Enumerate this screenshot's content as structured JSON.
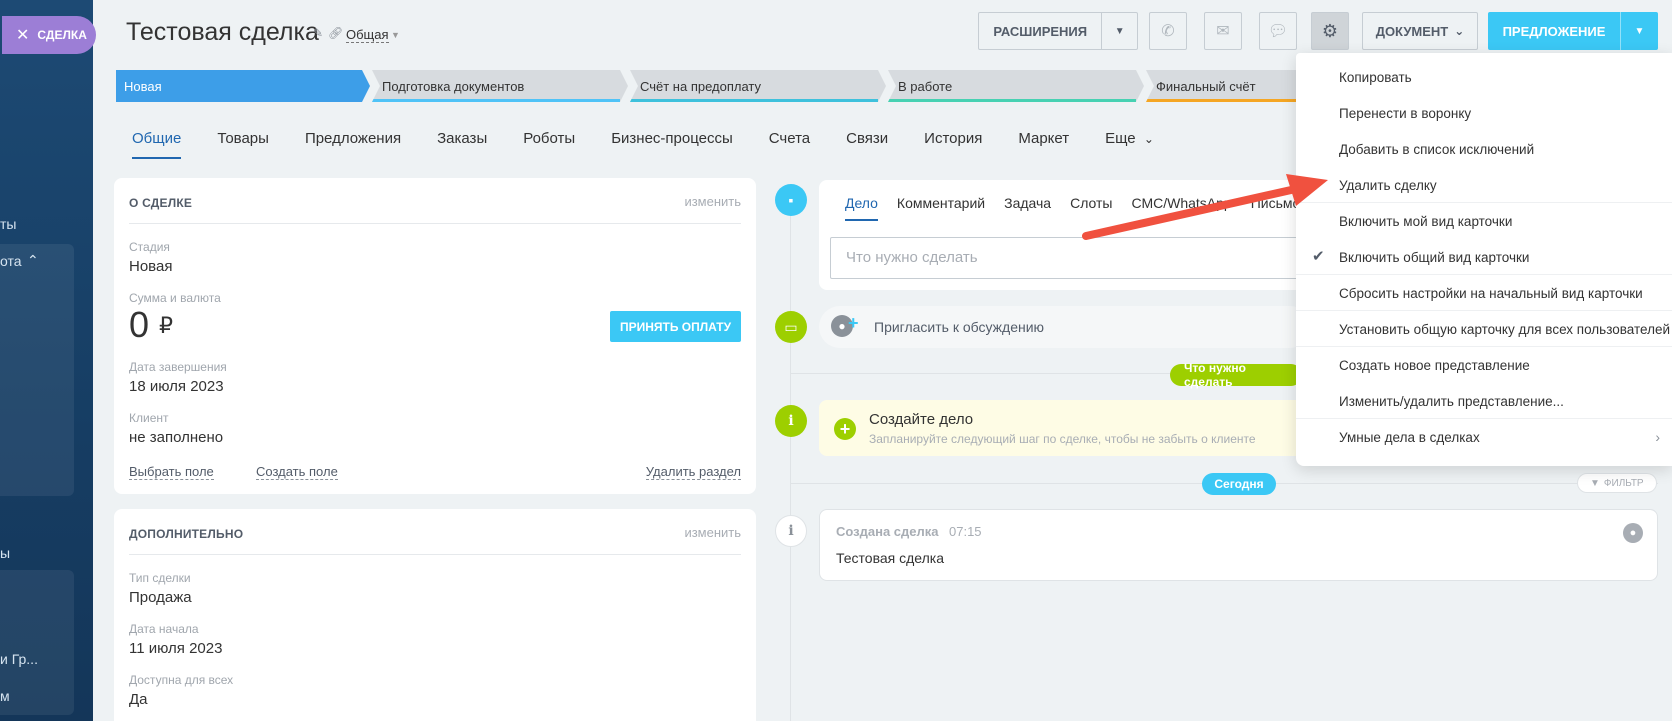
{
  "left_panel": {
    "close_deal_label": "СДЕЛКА",
    "fragment_1": "ты",
    "fragment_2": "ота",
    "fragment_3": "ы",
    "fragment_4": "и Гр...",
    "fragment_5": "м"
  },
  "header": {
    "title": "Тестовая сделка",
    "category": "Общая",
    "extensions_label": "РАСШИРЕНИЯ",
    "document_label": "ДОКУМЕНТ",
    "offer_label": "ПРЕДЛОЖЕНИЕ"
  },
  "stages": [
    {
      "label": "Новая",
      "color": "#3d9ee8"
    },
    {
      "label": "Подготовка документов",
      "color": "#4fc3f7"
    },
    {
      "label": "Счёт на предоплату",
      "color": "#3ec1dc"
    },
    {
      "label": "В работе",
      "color": "#47d1b2"
    },
    {
      "label": "Финальный счёт",
      "color": "#f5a623"
    }
  ],
  "tabs": [
    "Общие",
    "Товары",
    "Предложения",
    "Заказы",
    "Роботы",
    "Бизнес-процессы",
    "Счета",
    "Связи",
    "История",
    "Маркет",
    "Еще"
  ],
  "about": {
    "heading": "О СДЕЛКЕ",
    "edit": "изменить",
    "stage_label": "Стадия",
    "stage_value": "Новая",
    "amount_label": "Сумма и валюта",
    "amount_value": "0",
    "currency": "₽",
    "pay_button": "ПРИНЯТЬ ОПЛАТУ",
    "close_date_label": "Дата завершения",
    "close_date_value": "18 июля 2023",
    "client_label": "Клиент",
    "client_value": "не заполнено",
    "choose_field": "Выбрать поле",
    "create_field": "Создать поле",
    "delete_section": "Удалить раздел"
  },
  "extra": {
    "heading": "ДОПОЛНИТЕЛЬНО",
    "edit": "изменить",
    "deal_type_label": "Тип сделки",
    "deal_type_value": "Продажа",
    "start_date_label": "Дата начала",
    "start_date_value": "11 июля 2023",
    "available_label": "Доступна для всех",
    "available_value": "Да"
  },
  "timeline": {
    "composer_tabs": [
      "Дело",
      "Комментарий",
      "Задача",
      "Слоты",
      "СМС/WhatsApp",
      "Письмо"
    ],
    "todo_placeholder": "Что нужно сделать",
    "invite": "Пригласить к обсуждению",
    "todo_pill": "Что нужно сделать",
    "create_title": "Создайте дело",
    "create_sub": "Запланируйте следующий шаг по сделке, чтобы не забыть о клиенте",
    "today_pill": "Сегодня",
    "filter": "ФИЛЬТР",
    "event_title": "Создана сделка",
    "event_time": "07:15",
    "event_body": "Тестовая сделка"
  },
  "menu": {
    "items": [
      "Копировать",
      "Перенести в воронку",
      "Добавить в список исключений",
      "Удалить сделку",
      "Включить мой вид карточки",
      "Включить общий вид карточки",
      "Сбросить настройки на начальный вид карточки",
      "Установить общую карточку для всех пользователей",
      "Создать новое представление",
      "Изменить/удалить представление...",
      "Умные дела в сделках"
    ]
  },
  "colors": {
    "accent": "#3bc8f5",
    "link": "#2067b0",
    "green": "#9dcf00",
    "arrow": "#f0513f"
  }
}
